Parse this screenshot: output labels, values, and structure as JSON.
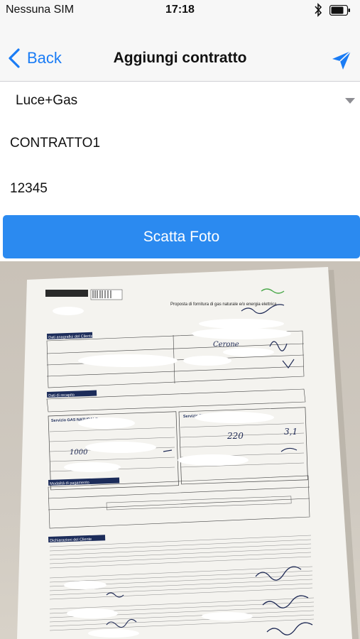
{
  "status_bar": {
    "carrier": "Nessuna SIM",
    "time": "17:18",
    "bluetooth_icon": "bluetooth-icon",
    "battery_icon": "battery-icon"
  },
  "nav": {
    "back_label": "Back",
    "title": "Aggiungi contratto",
    "send_icon": "send-icon"
  },
  "form": {
    "type_value": "Luce+Gas",
    "contract_name_value": "CONTRATTO1",
    "contract_number_value": "12345",
    "photo_button_label": "Scatta Foto"
  },
  "colors": {
    "accent": "#1a7cf5",
    "button": "#2b8af0"
  },
  "photo": {
    "header_text": "Proposta di fornitura di gas naturale e/o energia elettrica",
    "section_1": "Dati anagrafici del Cliente",
    "section_2": "Dati di recapito",
    "section_3": "Servizio GAS NATURALE",
    "section_4": "Servizio ENERGIA ELETTRICA",
    "section_5": "Modalità di pagamento",
    "section_6": "Dichiarazioni del Cliente",
    "handwriting_1": "Cerone",
    "handwriting_2": "220",
    "handwriting_3": "3,1",
    "handwriting_4": "1000"
  }
}
